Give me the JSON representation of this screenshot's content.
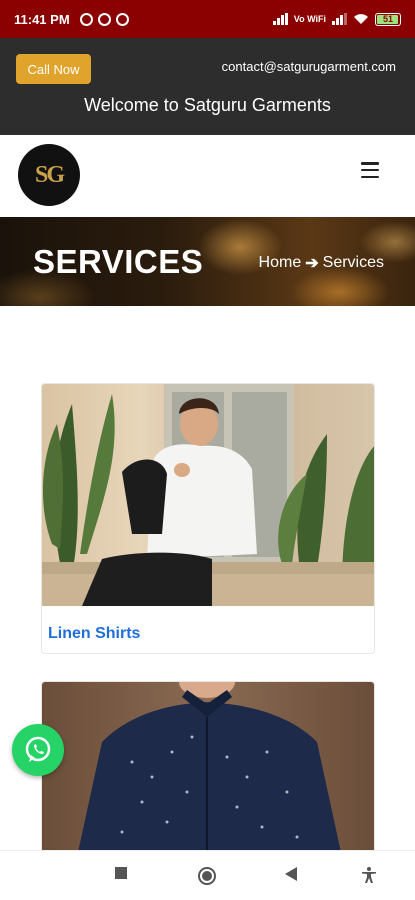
{
  "status_bar": {
    "time": "11:41 PM",
    "battery": "51",
    "network_label": "Vo WiFi"
  },
  "topbar": {
    "call_label": "Call Now",
    "email": "contact@satgurugarment.com",
    "welcome": "Welcome to Satguru Garments"
  },
  "header": {
    "logo_text": "SG",
    "menu_icon": "hamburger-menu-icon"
  },
  "banner": {
    "title": "SERVICES",
    "breadcrumb": {
      "home": "Home",
      "separator": "➔",
      "current": "Services"
    }
  },
  "services": [
    {
      "title": "Linen Shirts",
      "image": "man-in-white-linen-shirt-photo"
    },
    {
      "title": "",
      "image": "man-in-navy-dotted-shirt-photo"
    }
  ],
  "floating": {
    "icon": "whatsapp-icon"
  },
  "colors": {
    "status_bar": "#8b0000",
    "topbar": "#2d2d2d",
    "call_button": "#e0a42d",
    "card_title": "#1e6fd9",
    "whatsapp": "#25d366"
  }
}
